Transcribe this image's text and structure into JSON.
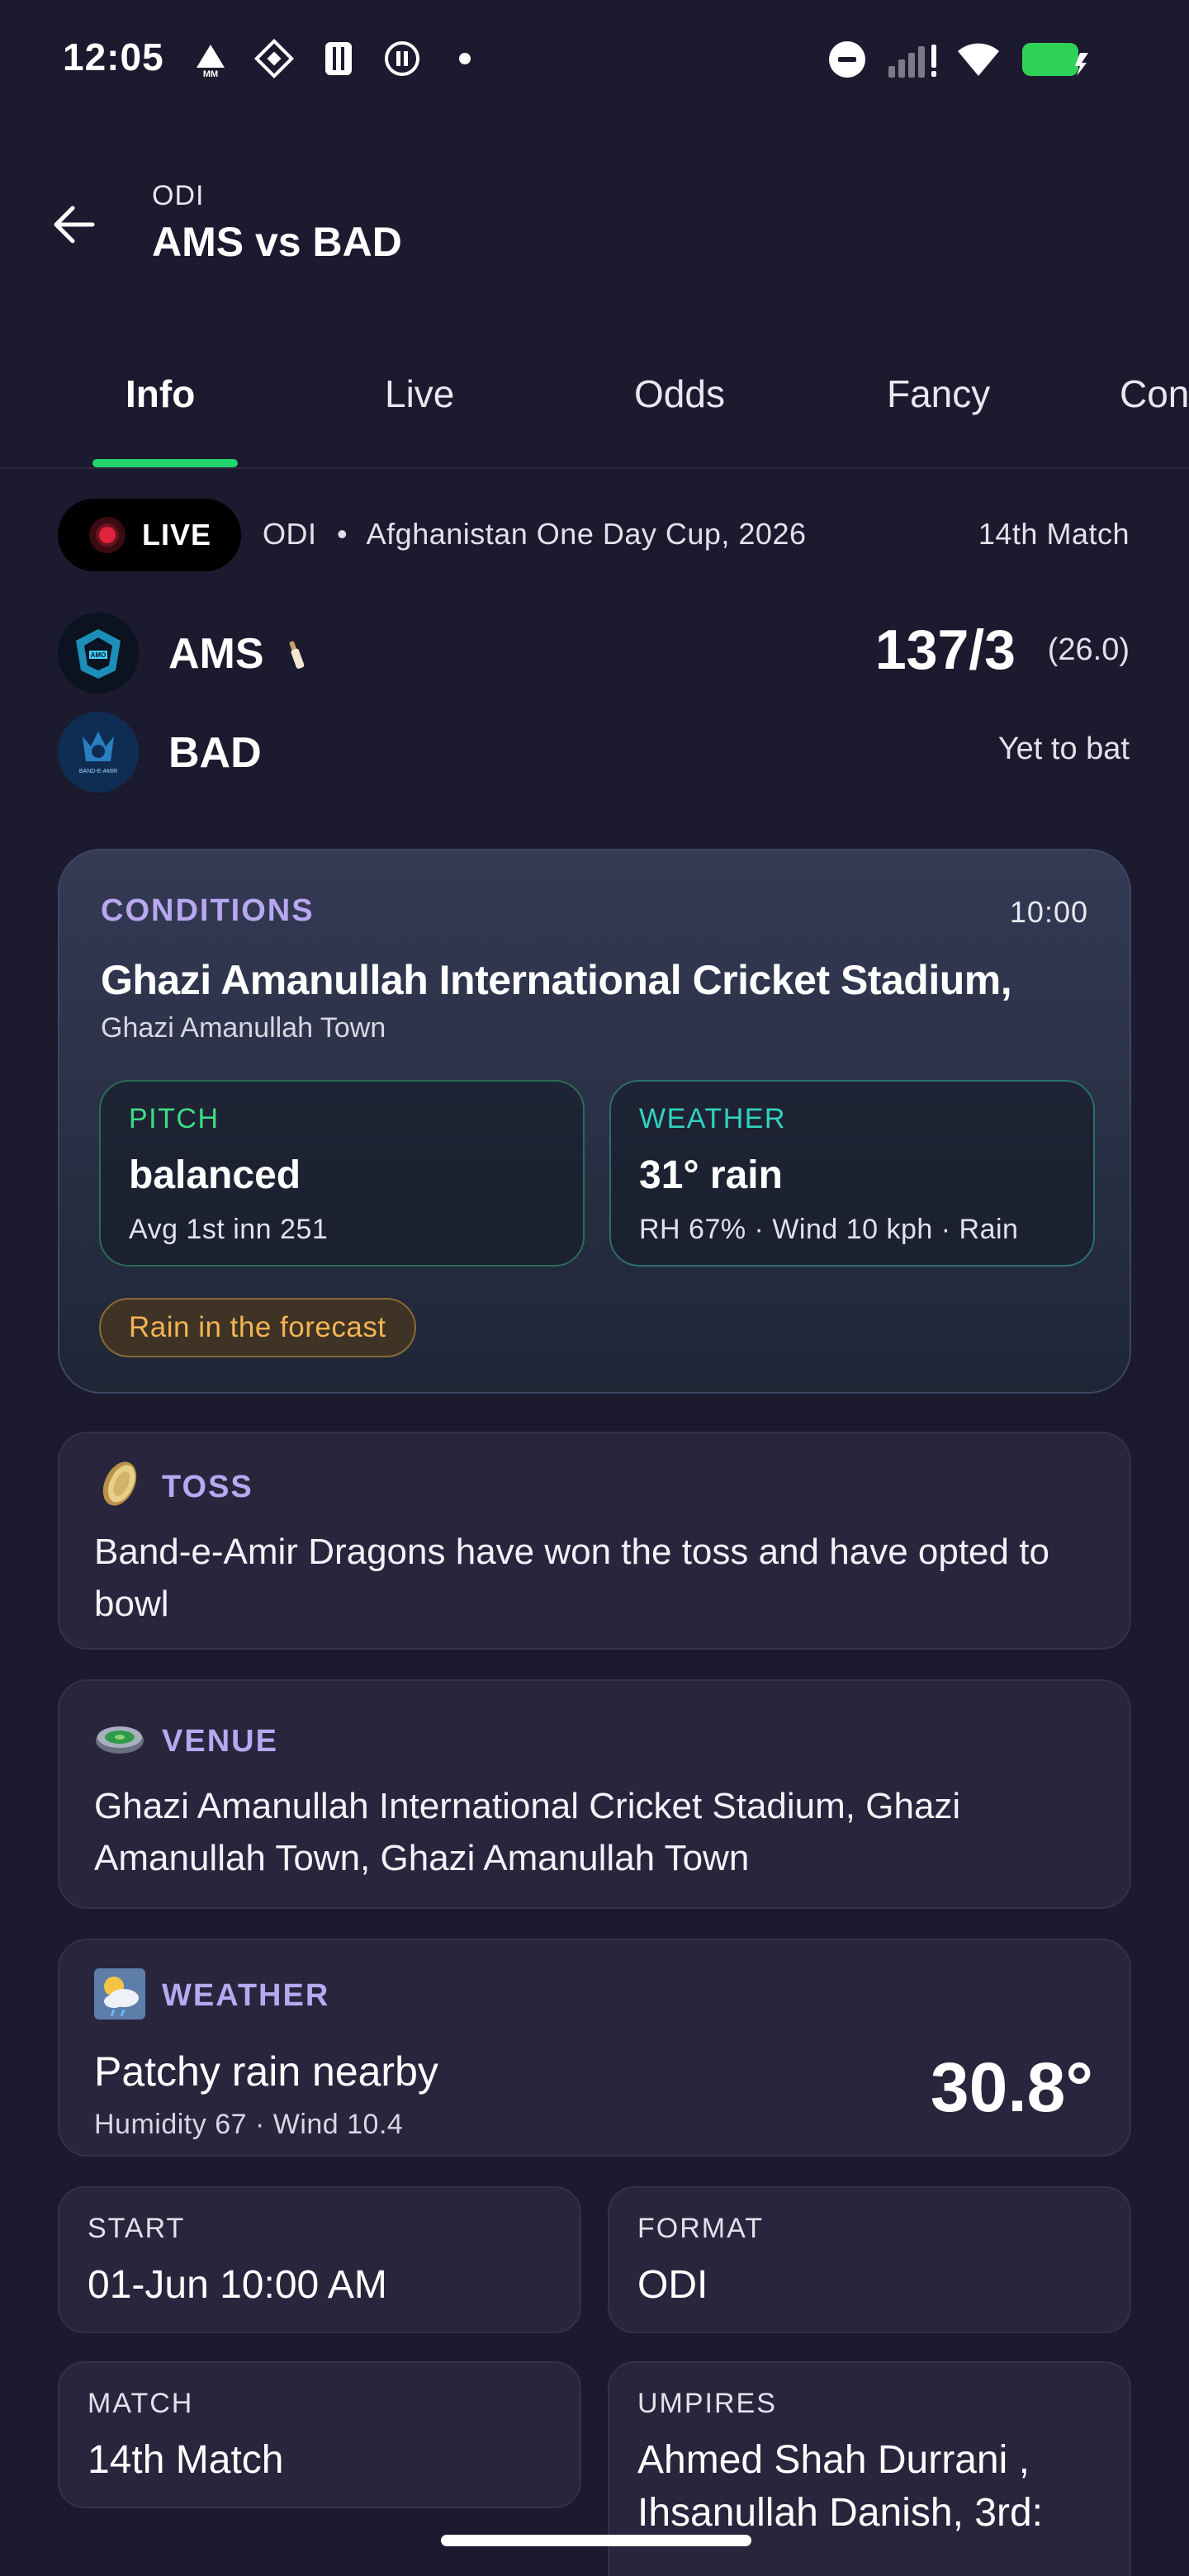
{
  "status_bar": {
    "time": "12:05"
  },
  "header": {
    "subtitle": "ODI",
    "title": "AMS vs BAD"
  },
  "tabs": [
    {
      "label": "Info",
      "active": true
    },
    {
      "label": "Live"
    },
    {
      "label": "Odds"
    },
    {
      "label": "Fancy"
    },
    {
      "label": "Con"
    }
  ],
  "match_meta": {
    "live_label": "LIVE",
    "format": "ODI",
    "separator": "•",
    "tournament": "Afghanistan One Day Cup, 2026",
    "match_no": "14th Match"
  },
  "teams": [
    {
      "short": "AMS",
      "score": "137/3",
      "overs": "(26.0)",
      "batting": true
    },
    {
      "short": "BAD",
      "status": "Yet to bat"
    }
  ],
  "conditions": {
    "label": "CONDITIONS",
    "time": "10:00",
    "venue": "Ghazi Amanullah International Cricket Stadium,",
    "town": "Ghazi Amanullah Town",
    "pitch": {
      "label": "PITCH",
      "value": "balanced",
      "sub": "Avg 1st inn 251",
      "color": "#3ddc84"
    },
    "weather": {
      "label": "WEATHER",
      "value": "31°  rain",
      "sub": "RH 67% · Wind 10 kph · Rain",
      "color": "#2fd4c0"
    },
    "alert": "Rain in the forecast"
  },
  "toss": {
    "label": "TOSS",
    "text": "Band-e-Amir Dragons have won the toss and have opted to bowl"
  },
  "venue": {
    "label": "VENUE",
    "text": "Ghazi Amanullah International Cricket Stadium, Ghazi Amanullah Town, Ghazi Amanullah Town"
  },
  "weather_card": {
    "label": "WEATHER",
    "summary": "Patchy rain nearby",
    "details": "Humidity 67 · Wind 10.4",
    "temp": "30.8°"
  },
  "details": {
    "start_label": "START",
    "start_value": "01-Jun 10:00 AM",
    "format_label": "FORMAT",
    "format_value": "ODI",
    "match_label": "MATCH",
    "match_value": "14th Match",
    "umpires_label": "UMPIRES",
    "umpires_value": "Ahmed Shah Durrani , Ihsanullah Danish, 3rd:"
  },
  "colors": {
    "background": "#1b1a2e",
    "tab_indicator": "#22d46e",
    "section_label": "#b8a8f0",
    "alert_text": "#f4b454"
  }
}
